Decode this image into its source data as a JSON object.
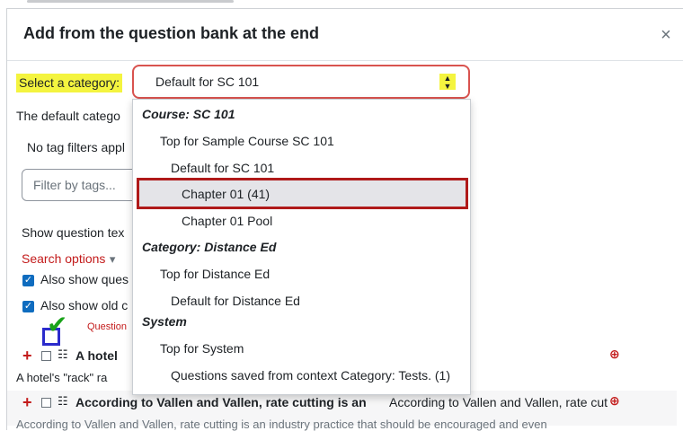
{
  "dialog": {
    "title": "Add from the question bank at the end",
    "close_glyph": "×"
  },
  "category": {
    "label": "Select a category:",
    "selected": "Default for SC 101",
    "arrow_glyph": "▲▼"
  },
  "background": {
    "default_category_text": "The default catego",
    "no_tag_text": "No tag filters appl",
    "filter_placeholder": "Filter by tags...",
    "show_question_text": "Show question tex",
    "search_options": "Search options",
    "search_caret": "▾",
    "also_show_questions": "Also show ques",
    "also_show_old": "Also show old c",
    "question_header": "Question"
  },
  "dropdown": {
    "items": [
      {
        "label": "Course: SC 101",
        "group": true
      },
      {
        "label": "Top for Sample Course SC 101",
        "group": false
      },
      {
        "label": "Default for SC 101",
        "group": false
      },
      {
        "label": "Chapter 01 (41)",
        "group": false,
        "selected": true
      },
      {
        "label": "Chapter 01 Pool",
        "group": false
      },
      {
        "label": "Category: Distance Ed",
        "group": true
      },
      {
        "label": "Top for Distance Ed",
        "group": false
      },
      {
        "label": "Default for Distance Ed",
        "group": false
      },
      {
        "label": "System",
        "group": true
      },
      {
        "label": "Top for System",
        "group": false
      },
      {
        "label": "Questions saved from context Category: Tests. (1)",
        "group": false
      }
    ]
  },
  "questions": [
    {
      "name": "A hotel",
      "preview": "A hotel's \"rack\" ra"
    },
    {
      "name": "According to Vallen and Vallen, rate cutting is an",
      "text": "According to Vallen and Vallen, rate cut",
      "preview": "According to Vallen and Vallen, rate cutting is an industry practice that should be encouraged and even"
    }
  ],
  "icons": {
    "plus": "+",
    "list": "☷",
    "zoom": "⊕",
    "check": "✓",
    "tick_annotation": "✔"
  },
  "colors": {
    "highlight": "#f4f43f",
    "link_red": "#c31b1b",
    "selection_border": "#b01a1a",
    "checkbox_blue": "#0f6cbf"
  }
}
